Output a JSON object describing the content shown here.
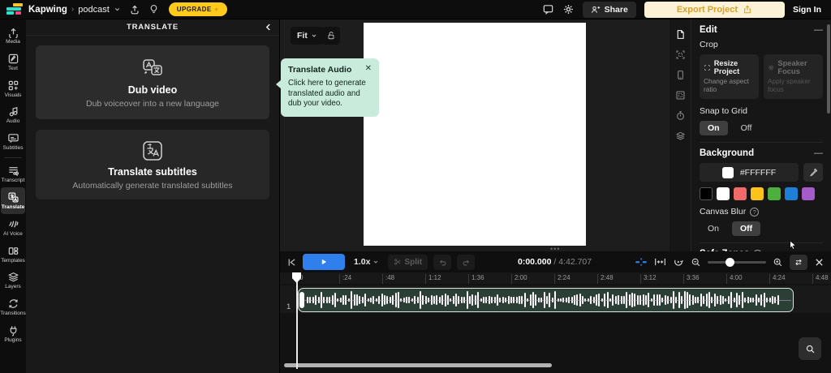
{
  "topbar": {
    "brand": "Kapwing",
    "breadcrumb_separator": "›",
    "project_name": "podcast",
    "upgrade_label": "UPGRADE",
    "share_label": "Share",
    "export_label": "Export Project",
    "signin_label": "Sign In"
  },
  "sidebar": {
    "items": [
      {
        "label": "Media",
        "icon": "media-upload-icon",
        "active": false
      },
      {
        "label": "Text",
        "icon": "text-icon",
        "active": false
      },
      {
        "label": "Visuals",
        "icon": "visuals-icon",
        "active": false
      },
      {
        "label": "Audio",
        "icon": "audio-icon",
        "active": false
      },
      {
        "label": "Subtitles",
        "icon": "subtitles-icon",
        "active": false
      },
      {
        "label": "Transcript",
        "icon": "transcript-icon",
        "active": false
      },
      {
        "label": "Translate",
        "icon": "translate-icon",
        "active": true
      },
      {
        "label": "AI Voice",
        "icon": "ai-voice-icon",
        "active": false
      },
      {
        "label": "Templates",
        "icon": "templates-icon",
        "active": false
      },
      {
        "label": "Layers",
        "icon": "layers-icon",
        "active": false
      },
      {
        "label": "Transitions",
        "icon": "transitions-icon",
        "active": false
      },
      {
        "label": "Plugins",
        "icon": "plugins-icon",
        "active": false
      }
    ]
  },
  "translate_panel": {
    "title": "TRANSLATE",
    "cards": [
      {
        "title": "Dub video",
        "subtitle": "Dub voiceover into a new language"
      },
      {
        "title": "Translate subtitles",
        "subtitle": "Automatically generate translated subtitles"
      }
    ]
  },
  "tooltip": {
    "title": "Translate Audio",
    "body": "Click here to generate translated audio and dub your video.",
    "close_label": "✕"
  },
  "canvas": {
    "fit_label": "Fit"
  },
  "edit_panel": {
    "title": "Edit",
    "crop_label": "Crop",
    "resize_title": "Resize Project",
    "resize_subtitle": "Change aspect ratio",
    "speaker_title": "Speaker Focus",
    "speaker_subtitle": "Apply speaker focus",
    "snap_label": "Snap to Grid",
    "on_label": "On",
    "off_label": "Off",
    "background_label": "Background",
    "background_hex": "#FFFFFF",
    "swatches": [
      "#000000",
      "#FFFFFF",
      "#F16A6A",
      "#FFC21A",
      "#4CAF3E",
      "#1E7FD6",
      "#A55BC9"
    ],
    "canvas_blur_label": "Canvas Blur",
    "safe_zones_label": "Safe Zones",
    "help_glyph": "?"
  },
  "timeline": {
    "speed_label": "1.0x",
    "split_label": "Split",
    "current_time": "0:00.000",
    "time_separator": " / ",
    "total_time": "4:42.707",
    "ruler_ticks": [
      "0",
      ":24",
      ":48",
      "1:12",
      "1:36",
      "2:00",
      "2:24",
      "2:48",
      "3:12",
      "3:36",
      "4:00",
      "4:24",
      "4:48"
    ],
    "track_number": "1"
  },
  "colors": {
    "accent_blue": "#2F80ED",
    "tooltip_mint": "#C8EBDC",
    "upgrade_yellow": "#FFCA1C",
    "export_cream": "#FBF2D7",
    "export_text": "#D9A12A",
    "clip_green": "#2B3F36",
    "canvas_white": "#FFFFFF"
  }
}
